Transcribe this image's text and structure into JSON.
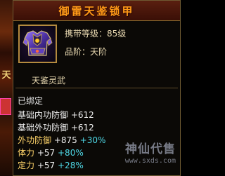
{
  "background": {
    "glyph": "天"
  },
  "tooltip": {
    "title": "御雷天鉴锁甲",
    "required_level": "携带等级：85级",
    "grade": "品阶：天阶",
    "item_name": "天鉴灵武",
    "status": "已绑定",
    "stats": [
      {
        "label": "基础内功防御",
        "value": "+612",
        "bonus": ""
      },
      {
        "label": "基础外功防御",
        "value": "+612",
        "bonus": ""
      },
      {
        "label": "外功防御",
        "value": "+875",
        "bonus": "+30%"
      },
      {
        "label": "体力",
        "value": "+57",
        "bonus": "+80%"
      },
      {
        "label": "定力",
        "value": "+57",
        "bonus": "+28%"
      }
    ],
    "icon": "armor-icon"
  },
  "watermark": {
    "text": "神仙代售",
    "url": "www.sxds.com"
  },
  "colors": {
    "title": "#ff9a18",
    "panel_border": "#6e5a32",
    "bonus": "#4fd8e6",
    "highlight": "#ffd46a"
  }
}
